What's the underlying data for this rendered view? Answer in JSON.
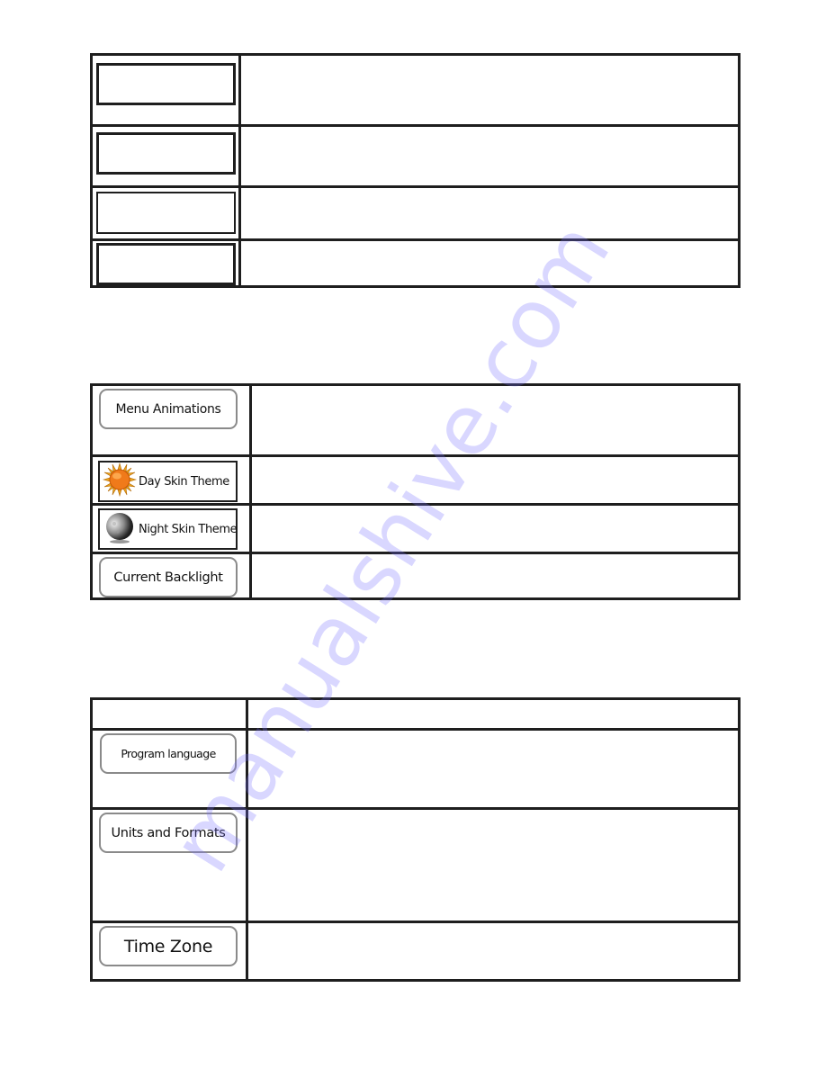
{
  "watermark": "manualshive.com",
  "table1": {
    "rows": [
      {
        "button_label": "",
        "description": ""
      },
      {
        "button_label": "",
        "description": ""
      },
      {
        "button_label": "",
        "description": ""
      },
      {
        "button_label": "",
        "description": ""
      }
    ]
  },
  "table2": {
    "rows": [
      {
        "button_label": "Menu Animations",
        "icon": null,
        "description": ""
      },
      {
        "button_label": "Day Skin Theme",
        "icon": "sun-icon",
        "description": ""
      },
      {
        "button_label": "Night Skin Theme",
        "icon": "moon-icon",
        "description": ""
      },
      {
        "button_label": "Current Backlight",
        "icon": null,
        "description": ""
      }
    ]
  },
  "table3": {
    "header": {
      "col1": "",
      "col2": ""
    },
    "rows": [
      {
        "button_label": "Program language",
        "description": ""
      },
      {
        "button_label": "Units and Formats",
        "description": ""
      },
      {
        "button_label": "Time Zone",
        "description": ""
      }
    ]
  },
  "colors": {
    "border": "#1e1e1e",
    "button_border": "#8a8a8a",
    "sun_fill": "#f07a1a",
    "sun_rays": "#e8a21a",
    "watermark": "#786eff"
  }
}
